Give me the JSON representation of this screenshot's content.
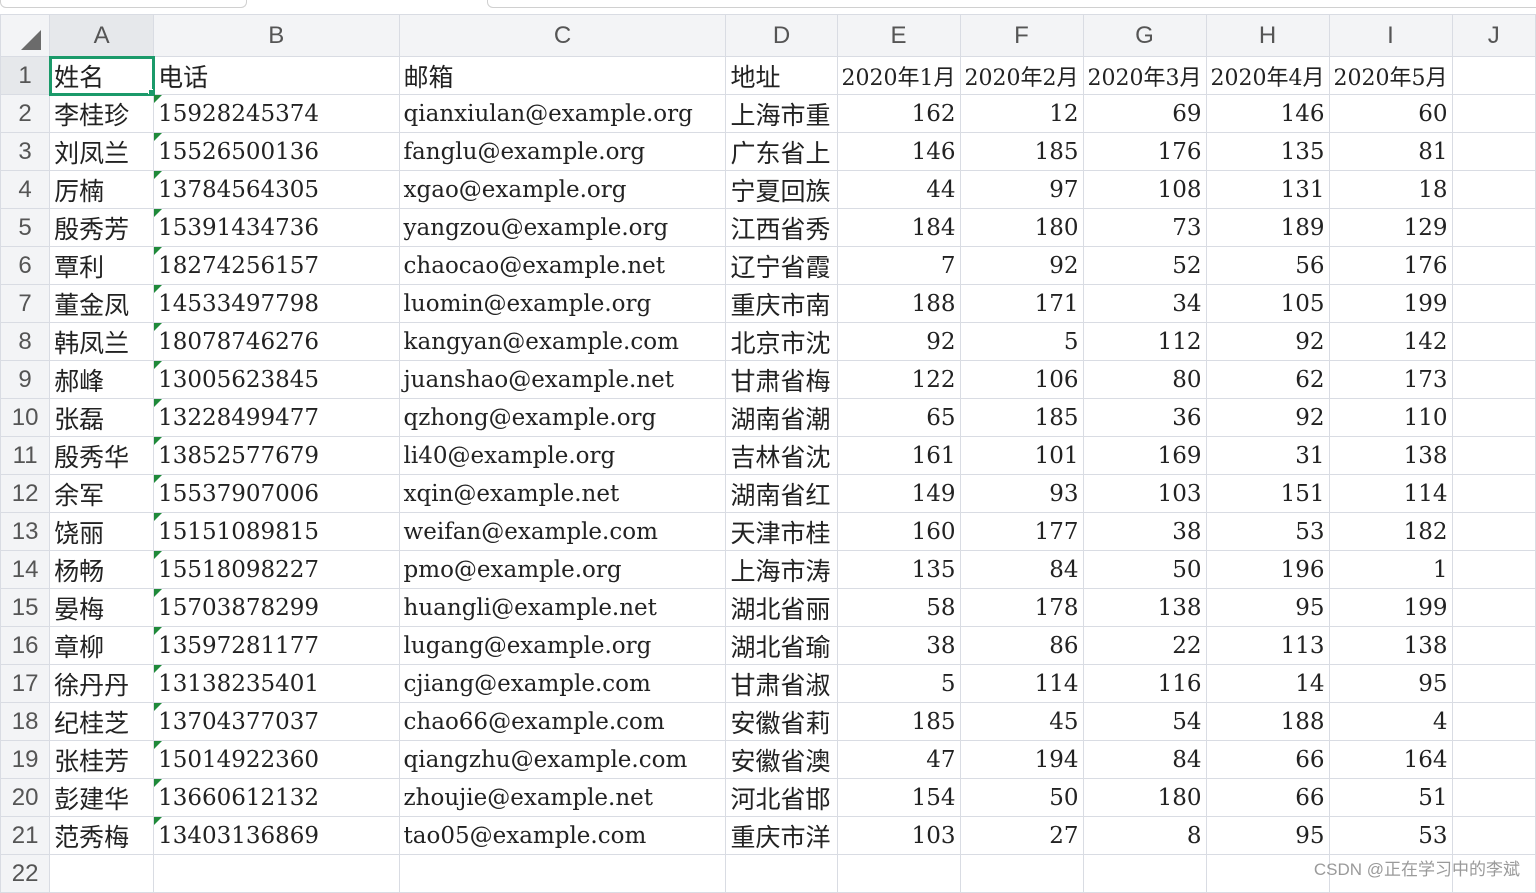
{
  "columns": [
    "A",
    "B",
    "C",
    "D",
    "E",
    "F",
    "G",
    "H",
    "I",
    "J"
  ],
  "rowNumbers": [
    "1",
    "2",
    "3",
    "4",
    "5",
    "6",
    "7",
    "8",
    "9",
    "10",
    "11",
    "12",
    "13",
    "14",
    "15",
    "16",
    "17",
    "18",
    "19",
    "20",
    "21",
    "22"
  ],
  "header": [
    "姓名",
    "电话",
    "邮箱",
    "地址",
    "2020年1月",
    "2020年2月",
    "2020年3月",
    "2020年4月",
    "2020年5月"
  ],
  "rows": [
    [
      "李桂珍",
      "15928245374",
      "qianxiulan@example.org",
      "上海市重",
      "162",
      "12",
      "69",
      "146",
      "60"
    ],
    [
      "刘凤兰",
      "15526500136",
      "fanglu@example.org",
      "广东省上",
      "146",
      "185",
      "176",
      "135",
      "81"
    ],
    [
      "厉楠",
      "13784564305",
      "xgao@example.org",
      "宁夏回族",
      "44",
      "97",
      "108",
      "131",
      "18"
    ],
    [
      "殷秀芳",
      "15391434736",
      "yangzou@example.org",
      "江西省秀",
      "184",
      "180",
      "73",
      "189",
      "129"
    ],
    [
      "覃利",
      "18274256157",
      "chaocao@example.net",
      "辽宁省霞",
      "7",
      "92",
      "52",
      "56",
      "176"
    ],
    [
      "董金凤",
      "14533497798",
      "luomin@example.org",
      "重庆市南",
      "188",
      "171",
      "34",
      "105",
      "199"
    ],
    [
      "韩凤兰",
      "18078746276",
      "kangyan@example.com",
      "北京市沈",
      "92",
      "5",
      "112",
      "92",
      "142"
    ],
    [
      "郝峰",
      "13005623845",
      "juanshao@example.net",
      "甘肃省梅",
      "122",
      "106",
      "80",
      "62",
      "173"
    ],
    [
      "张磊",
      "13228499477",
      "qzhong@example.org",
      "湖南省潮",
      "65",
      "185",
      "36",
      "92",
      "110"
    ],
    [
      "殷秀华",
      "13852577679",
      "li40@example.org",
      "吉林省沈",
      "161",
      "101",
      "169",
      "31",
      "138"
    ],
    [
      "余军",
      "15537907006",
      "xqin@example.net",
      "湖南省红",
      "149",
      "93",
      "103",
      "151",
      "114"
    ],
    [
      "饶丽",
      "15151089815",
      "weifan@example.com",
      "天津市桂",
      "160",
      "177",
      "38",
      "53",
      "182"
    ],
    [
      "杨畅",
      "15518098227",
      "pmo@example.org",
      "上海市涛",
      "135",
      "84",
      "50",
      "196",
      "1"
    ],
    [
      "晏梅",
      "15703878299",
      "huangli@example.net",
      "湖北省丽",
      "58",
      "178",
      "138",
      "95",
      "199"
    ],
    [
      "章柳",
      "13597281177",
      "lugang@example.org",
      "湖北省瑜",
      "38",
      "86",
      "22",
      "113",
      "138"
    ],
    [
      "徐丹丹",
      "13138235401",
      "cjiang@example.com",
      "甘肃省淑",
      "5",
      "114",
      "116",
      "14",
      "95"
    ],
    [
      "纪桂芝",
      "13704377037",
      "chao66@example.com",
      "安徽省莉",
      "185",
      "45",
      "54",
      "188",
      "4"
    ],
    [
      "张桂芳",
      "15014922360",
      "qiangzhu@example.com",
      "安徽省澳",
      "47",
      "194",
      "84",
      "66",
      "164"
    ],
    [
      "彭建华",
      "13660612132",
      "zhoujie@example.net",
      "河北省邯",
      "154",
      "50",
      "180",
      "66",
      "51"
    ],
    [
      "范秀梅",
      "13403136869",
      "tao05@example.com",
      "重庆市洋",
      "103",
      "27",
      "8",
      "95",
      "53"
    ]
  ],
  "watermark": "CSDN @正在学习中的李斌",
  "colors": {
    "selection": "#1b9a6a",
    "headerBg": "#f3f4f6",
    "gridLine": "#d9dce3"
  }
}
